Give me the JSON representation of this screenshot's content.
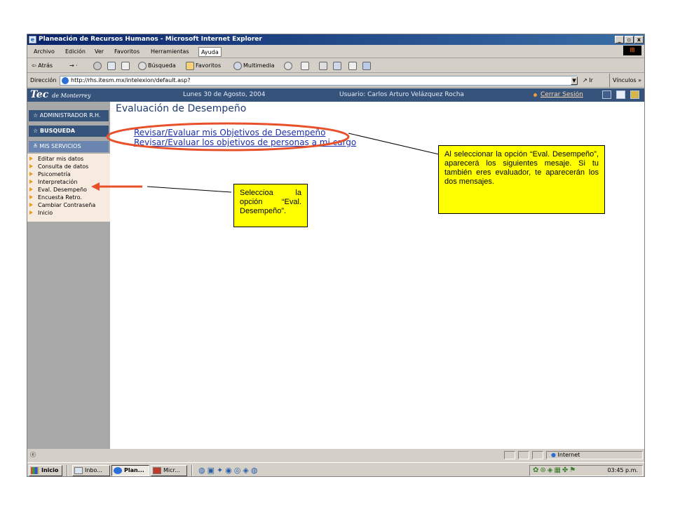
{
  "window": {
    "title": "Planeación de Recursos Humanos - Microsoft Internet Explorer",
    "min": "_",
    "max": "▫",
    "close": "x"
  },
  "menu": [
    "Archivo",
    "Edición",
    "Ver",
    "Favoritos",
    "Herramientas",
    "Ayuda"
  ],
  "toolbar": {
    "back": "Atrás",
    "search": "Búsqueda",
    "favorites": "Favoritos",
    "media": "Multimedia"
  },
  "address": {
    "label": "Dirección",
    "url": "http://rhs.itesm.mx/intelexion/default.asp?",
    "go": "Ir",
    "links": "Vínculos"
  },
  "page": {
    "logo_main": "Tec",
    "logo_sub": "de Monterrey",
    "date": "Lunes 30 de Agosto, 2004",
    "user": "Usuario: Carlos Arturo Velázquez Rocha",
    "logout": "Cerrar Sesión",
    "title": "Evaluación de Desempeño",
    "links": [
      "Revisar/Evaluar mis Objetivos de Desempeño",
      "Revisar/Evaluar los objetivos de personas a mi cargo"
    ]
  },
  "sidebar": {
    "headers": [
      "ADMINISTRADOR R.H.",
      "BUSQUEDA",
      "MIS SERVICIOS"
    ],
    "items": [
      "Editar mis datos",
      "Consulta de datos",
      "Psicometría",
      "Interpretación",
      "Eval. Desempeño",
      "Encuesta Retro.",
      "Cambiar Contraseña",
      "Inicio"
    ]
  },
  "status": {
    "zone": "Internet"
  },
  "taskbar": {
    "start": "Inicio",
    "tasks": [
      "Inbo...",
      "Plan...",
      "Micr..."
    ],
    "clock": "03:45 p.m."
  },
  "annotations": {
    "right": "Al seleccionar la opción “Eval. Desempeño”, aparecerá los siguientes mesaje. Si tu también eres evaluador, te aparecerán los dos mensajes.",
    "left": "Seleccioa la opción “Eval. Desempeño”."
  },
  "colors": {
    "header_bg": "#36537c",
    "highlight": "#ffff00",
    "callout": "#e8502a",
    "link": "#1d2fa8"
  }
}
